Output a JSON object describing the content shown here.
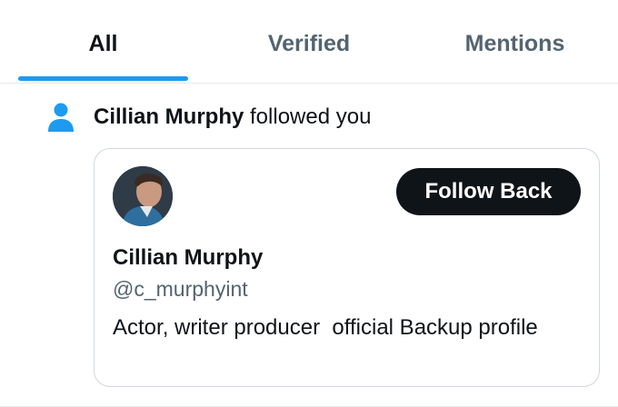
{
  "tabs": [
    {
      "label": "All",
      "active": true
    },
    {
      "label": "Verified",
      "active": false
    },
    {
      "label": "Mentions",
      "active": false
    }
  ],
  "colors": {
    "accent": "#1d9bf0",
    "text_primary": "#0f1419",
    "text_secondary": "#536471",
    "button_bg": "#0f1419"
  },
  "notification": {
    "icon": "person-icon",
    "actor_name": "Cillian Murphy",
    "action_text": "followed you",
    "card": {
      "avatar": "avatar",
      "follow_label": "Follow Back",
      "display_name": "Cillian Murphy",
      "handle": "@c_murphyint",
      "bio": "Actor, writer producer  official Backup profile"
    }
  }
}
